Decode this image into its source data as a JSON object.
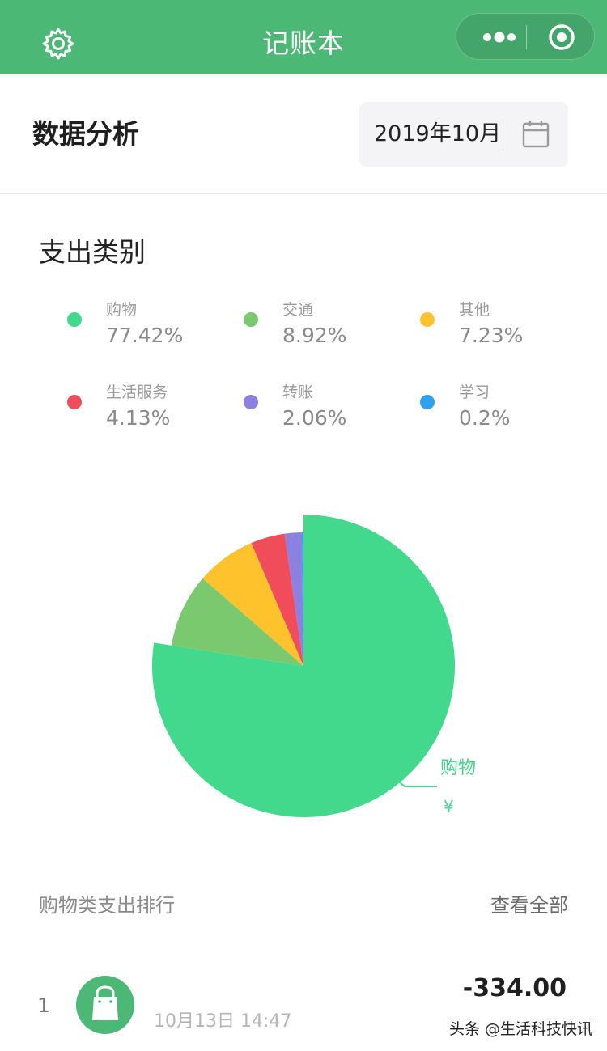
{
  "navbar": {
    "title": "记账本",
    "icons": {
      "settings": "gear-icon",
      "more": "more-dots-icon",
      "close": "target-circle-icon"
    },
    "color": "#4cb876"
  },
  "header": {
    "title": "数据分析",
    "month": "2019年10月",
    "calendar_icon": "calendar-icon"
  },
  "section": {
    "title": "支出类别"
  },
  "legend": [
    {
      "name": "购物",
      "percent": "77.42%",
      "color": "#42d98c"
    },
    {
      "name": "交通",
      "percent": "8.92%",
      "color": "#7bc96e"
    },
    {
      "name": "其他",
      "percent": "7.23%",
      "color": "#fec22c"
    },
    {
      "name": "生活服务",
      "percent": "4.13%",
      "color": "#f04c5a"
    },
    {
      "name": "转账",
      "percent": "2.06%",
      "color": "#8c80e0"
    },
    {
      "name": "学习",
      "percent": "0.2%",
      "color": "#2ba2f0"
    }
  ],
  "chart_data": {
    "type": "pie",
    "categories": [
      "购物",
      "交通",
      "其他",
      "生活服务",
      "转账",
      "学习"
    ],
    "values": [
      77.42,
      8.92,
      7.23,
      4.13,
      2.06,
      0.2
    ],
    "highlighted": "购物",
    "label": "购物",
    "label_value": "¥"
  },
  "ranking": {
    "title": "购物类支出排行",
    "view_all": "查看全部",
    "items": [
      {
        "index": "1",
        "date": "10月13日 14:47",
        "amount": "-334.00",
        "icon": "shopping-bag-icon"
      }
    ]
  },
  "watermark": "头条 @生活科技快讯"
}
